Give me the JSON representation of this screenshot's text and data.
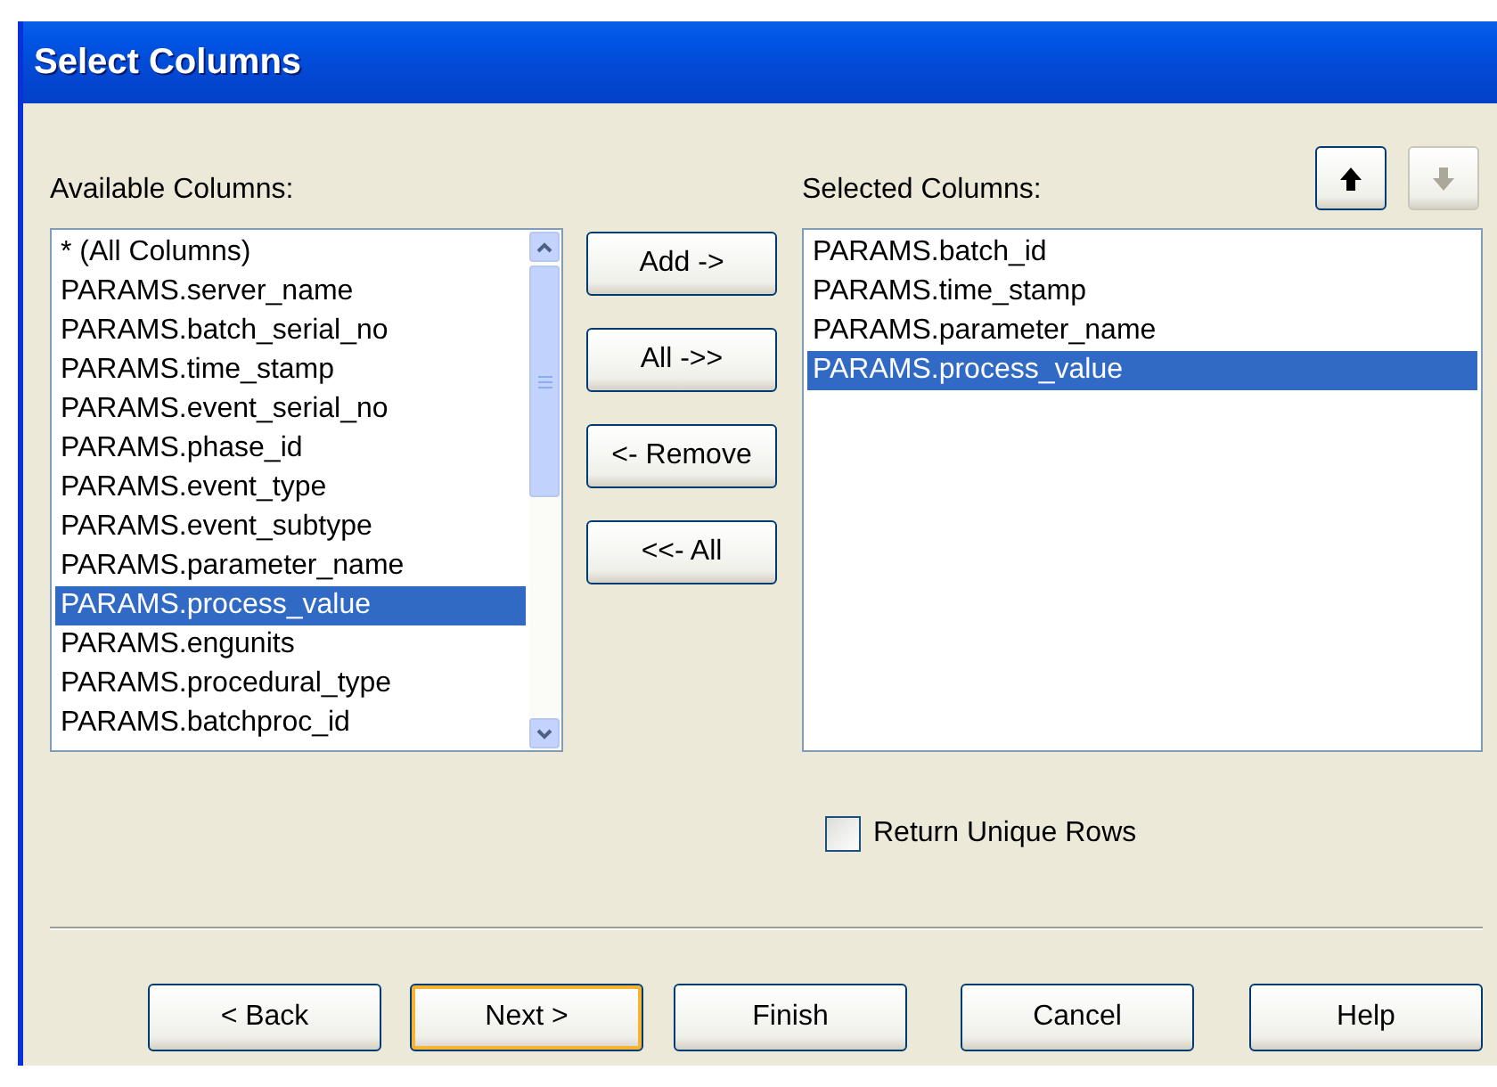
{
  "window": {
    "title": "Select Columns"
  },
  "order_buttons": [
    {
      "kind": "up",
      "disabled": false
    },
    {
      "kind": "down",
      "disabled": true
    }
  ],
  "available_columns": {
    "label": "Available Columns:",
    "items": [
      {
        "text": "* (All Columns)",
        "selected": false
      },
      {
        "text": "PARAMS.server_name",
        "selected": false
      },
      {
        "text": "PARAMS.batch_serial_no",
        "selected": false
      },
      {
        "text": "PARAMS.time_stamp",
        "selected": false
      },
      {
        "text": "PARAMS.event_serial_no",
        "selected": false
      },
      {
        "text": "PARAMS.phase_id",
        "selected": false
      },
      {
        "text": "PARAMS.event_type",
        "selected": false
      },
      {
        "text": "PARAMS.event_subtype",
        "selected": false
      },
      {
        "text": "PARAMS.parameter_name",
        "selected": false
      },
      {
        "text": "PARAMS.process_value",
        "selected": true
      },
      {
        "text": "PARAMS.engunits",
        "selected": false
      },
      {
        "text": "PARAMS.procedural_type",
        "selected": false
      },
      {
        "text": "PARAMS.batchproc_id",
        "selected": false
      }
    ]
  },
  "transfer_buttons": [
    "Add ->",
    "All ->>",
    "<- Remove",
    "<<- All"
  ],
  "selected_columns": {
    "label": "Selected Columns:",
    "items": [
      {
        "text": "PARAMS.batch_id",
        "selected": false
      },
      {
        "text": "PARAMS.time_stamp",
        "selected": false
      },
      {
        "text": "PARAMS.parameter_name",
        "selected": false
      },
      {
        "text": "PARAMS.process_value",
        "selected": true
      }
    ]
  },
  "unique_rows": {
    "label": "Return Unique Rows",
    "checked": false
  },
  "footer_buttons": [
    {
      "label": "< Back",
      "focused": false
    },
    {
      "label": "Next >",
      "focused": true
    },
    {
      "label": "Finish",
      "focused": false
    },
    {
      "label": "Cancel",
      "focused": false
    },
    {
      "label": "Help",
      "focused": false
    }
  ]
}
